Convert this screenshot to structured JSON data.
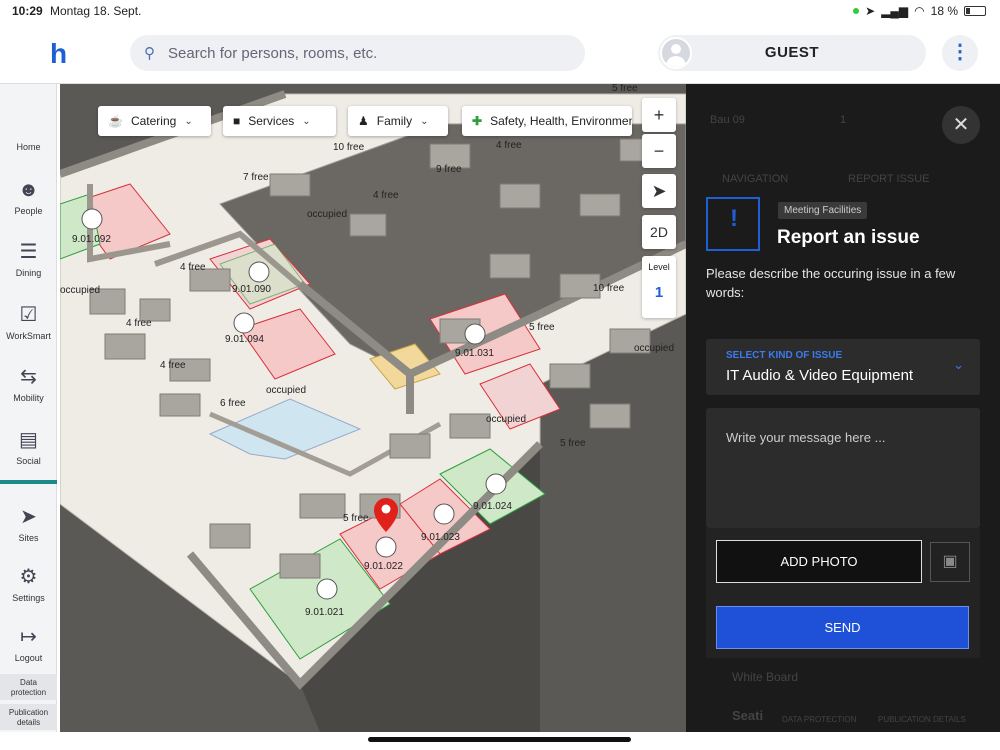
{
  "status_bar": {
    "time": "10:29",
    "date": "Montag 18. Sept.",
    "battery": "18 %"
  },
  "search": {
    "placeholder": "Search for persons, rooms, etc."
  },
  "user": {
    "name": "GUEST"
  },
  "sidebar": {
    "items": [
      {
        "label": "Home",
        "icon": "home-icon"
      },
      {
        "label": "People",
        "icon": "people-icon"
      },
      {
        "label": "Dining",
        "icon": "fork-knife-icon"
      },
      {
        "label": "WorkSmart",
        "icon": "worksmart-icon"
      },
      {
        "label": "Mobility",
        "icon": "arrows-icon"
      },
      {
        "label": "Social",
        "icon": "chat-icon"
      },
      {
        "label": "Sites",
        "icon": "location-arrow-icon"
      },
      {
        "label": "Settings",
        "icon": "gear-icon"
      },
      {
        "label": "Logout",
        "icon": "logout-icon"
      }
    ],
    "footer": {
      "data_protection": "Data protection",
      "publication": "Publication details"
    }
  },
  "map": {
    "filters": [
      {
        "label": "Catering",
        "icon": "catering-icon"
      },
      {
        "label": "Services",
        "icon": "services-icon"
      },
      {
        "label": "Family",
        "icon": "family-icon"
      },
      {
        "label": "Safety, Health, Environment",
        "icon": "plus-circle-icon"
      }
    ],
    "controls": {
      "zoom_in": "+",
      "zoom_out": "−",
      "view_2d": "2D",
      "level_label": "Level",
      "level_value": "1"
    },
    "labels": {
      "r1": "9.01.092",
      "r2": "9.01.090",
      "r3": "9.01.094",
      "r4": "9.01.031",
      "r5": "9.01.024",
      "r6": "9.01.023",
      "r7": "9.01.022",
      "r8": "9.01.021",
      "s1": "10 free",
      "s2": "7 free",
      "s3": "9 free",
      "s4": "4 free",
      "s5": "4 free",
      "s6": "4 free",
      "s7": "4 free",
      "s8": "6 free",
      "s9": "10 free",
      "s10": "5 free",
      "s11": "5 free",
      "s12": "5 free",
      "s13": "4 free",
      "s14": "5 free",
      "o1": "occupied",
      "o2": "occupied",
      "o3": "occupied",
      "o4": "occupied",
      "o5": "occupied"
    }
  },
  "panel": {
    "bg_text": {
      "a": "Bau 09",
      "b": "1",
      "nav": "NAVIGATION",
      "report": "REPORT ISSUE",
      "wb": "White Board",
      "seat": "Seati",
      "dp": "DATA PROTECTION",
      "pub": "PUBLICATION DETAILS"
    },
    "tag": "Meeting Facilities",
    "title": "Report an issue",
    "description": "Please describe the occuring issue in a few words:",
    "select_label": "SELECT KIND OF ISSUE",
    "select_value": "IT Audio & Video Equipment",
    "message_placeholder": "Write your message here ...",
    "add_photo": "ADD PHOTO",
    "send": "SEND"
  },
  "colors": {
    "accent": "#1e5fd6",
    "send": "#1e50d8",
    "occupied": "#d9303a",
    "free": "#2e9e3f"
  }
}
